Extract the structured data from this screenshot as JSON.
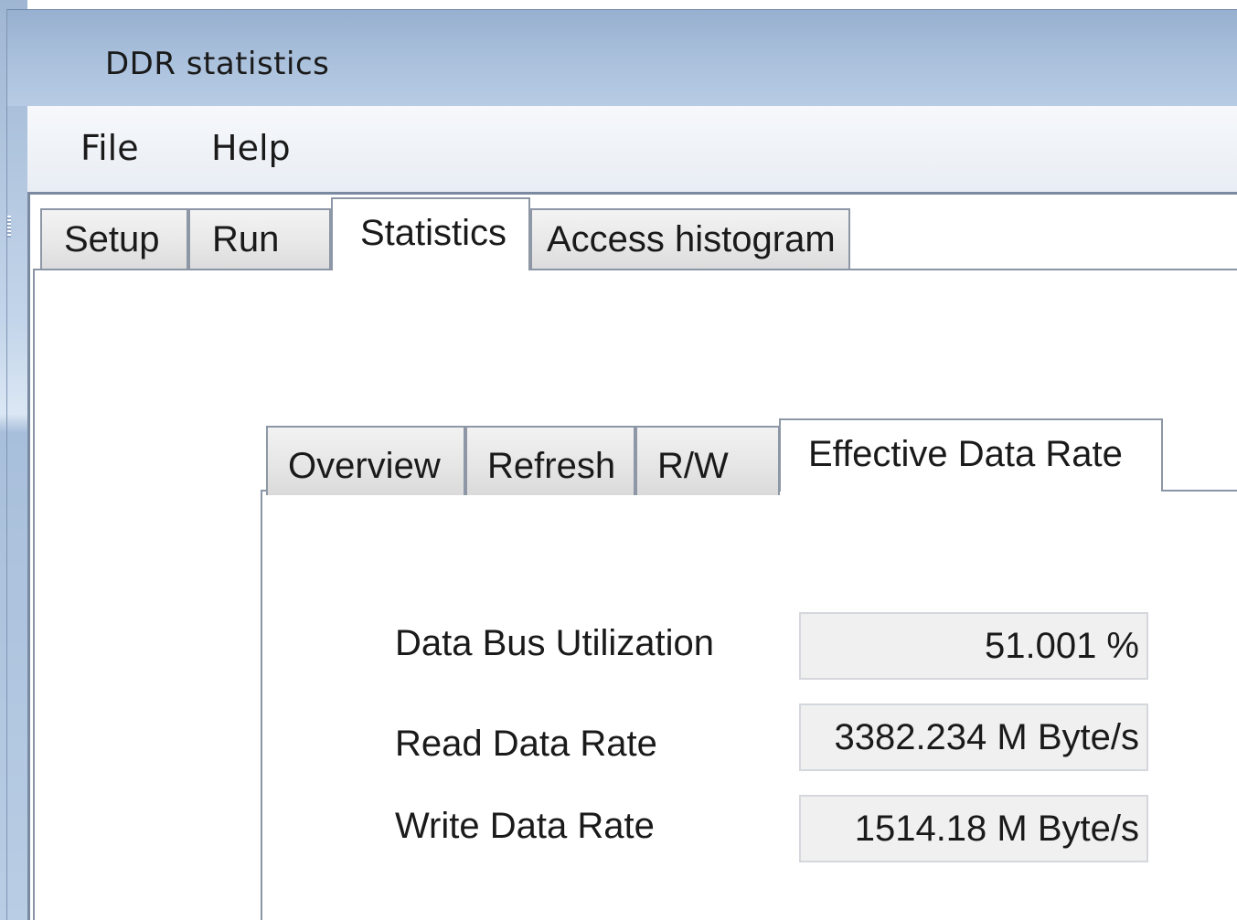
{
  "window": {
    "title": "DDR statistics"
  },
  "menu": {
    "items": [
      "File",
      "Help"
    ]
  },
  "main_tabs": [
    {
      "label": "Setup",
      "active": false
    },
    {
      "label": "Run",
      "active": false
    },
    {
      "label": "Statistics",
      "active": true
    },
    {
      "label": "Access histogram",
      "active": false
    }
  ],
  "stat_tabs": [
    {
      "label": "Overview",
      "active": false
    },
    {
      "label": "Refresh",
      "active": false
    },
    {
      "label": "R/W",
      "active": false
    },
    {
      "label": "Effective Data Rate",
      "active": true
    }
  ],
  "stats": [
    {
      "label": "Data Bus Utilization",
      "value": "51.001 %"
    },
    {
      "label": "Read Data Rate",
      "value": "3382.234 M Byte/s"
    },
    {
      "label": "Write Data Rate",
      "value": "1514.18 M Byte/s"
    }
  ],
  "colors": {
    "titlebar": "#a9c0dc",
    "tab_border": "#8e97a6",
    "value_box": "#f0f0f0"
  }
}
